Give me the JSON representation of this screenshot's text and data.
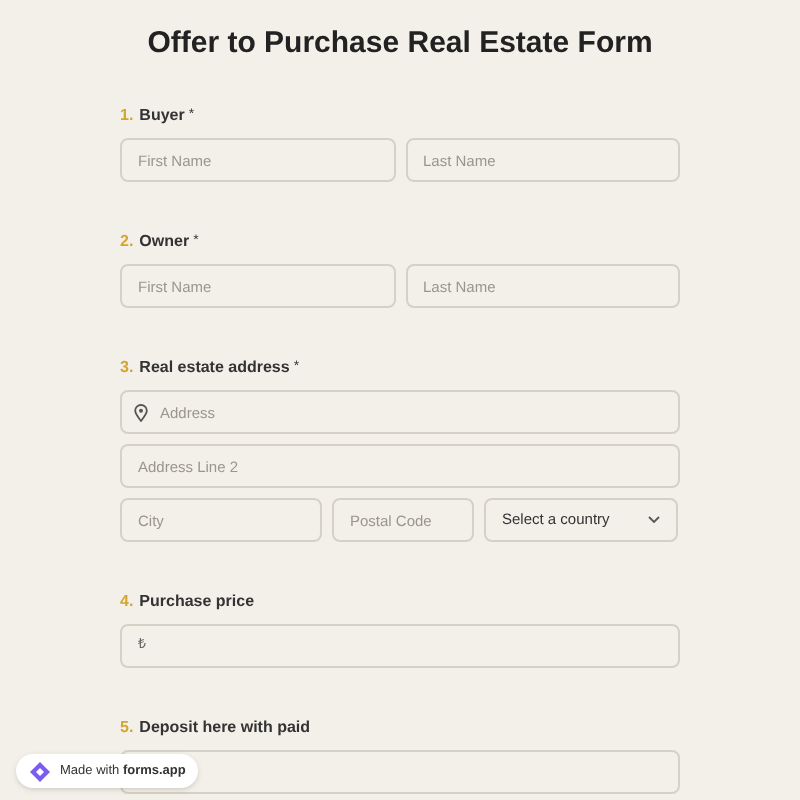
{
  "title": "Offer to Purchase Real Estate Form",
  "questions": [
    {
      "number": "1.",
      "label": "Buyer",
      "required_mark": "*",
      "rows": [
        [
          {
            "kind": "text",
            "placeholder": "First Name"
          },
          {
            "kind": "text",
            "placeholder": "Last Name"
          }
        ]
      ]
    },
    {
      "number": "2.",
      "label": "Owner",
      "required_mark": "*",
      "rows": [
        [
          {
            "kind": "text",
            "placeholder": "First Name"
          },
          {
            "kind": "text",
            "placeholder": "Last Name"
          }
        ]
      ]
    },
    {
      "number": "3.",
      "label": "Real estate address",
      "required_mark": "*",
      "rows": [
        [
          {
            "kind": "address",
            "placeholder": "Address"
          }
        ],
        [
          {
            "kind": "text",
            "placeholder": "Address Line 2"
          }
        ],
        [
          {
            "kind": "text",
            "placeholder": "City"
          },
          {
            "kind": "text",
            "placeholder": "Postal Code"
          },
          {
            "kind": "select",
            "value": "Select a country"
          }
        ]
      ]
    },
    {
      "number": "4.",
      "label": "Purchase price",
      "rows": [
        [
          {
            "kind": "currency",
            "symbol": "₺"
          }
        ]
      ]
    },
    {
      "number": "5.",
      "label": "Deposit here with paid",
      "rows": [
        [
          {
            "kind": "currency"
          }
        ]
      ]
    }
  ],
  "badge": {
    "prefix": "Made with",
    "brand": "forms.app"
  }
}
